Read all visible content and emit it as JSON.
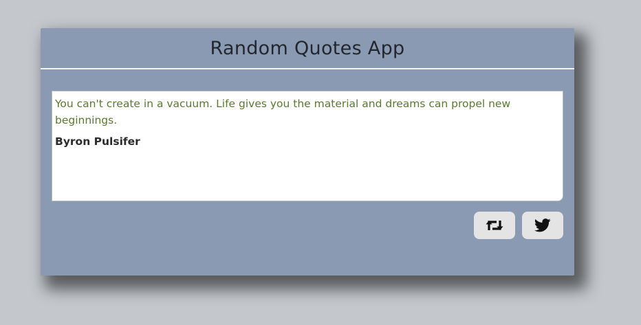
{
  "app": {
    "title": "Random Quotes App"
  },
  "quote": {
    "text": "You can't create in a vacuum. Life gives you the material and dreams can propel new beginnings.",
    "author": "Byron Pulsifer"
  },
  "actions": [
    {
      "name": "new-quote",
      "icon": "retweet-icon"
    },
    {
      "name": "tweet-quote",
      "icon": "twitter-bird-icon"
    }
  ],
  "colors": {
    "page_background": "#c4c8cc",
    "card_background": "#8a9ab3",
    "quote_text": "#5a7a2e",
    "author_text": "#2c2c2c",
    "button_background": "#e4e4e4"
  }
}
